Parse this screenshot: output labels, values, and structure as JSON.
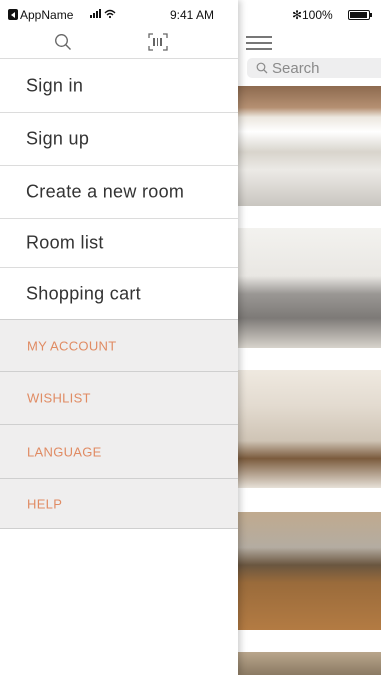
{
  "status_bar": {
    "app_name": "AppName",
    "time": "9:41 AM",
    "bluetooth": "✻",
    "battery_percent": "100%"
  },
  "drawer": {
    "menu_items": [
      {
        "label": "Sign in"
      },
      {
        "label": "Sign up"
      },
      {
        "label": "Create a new room"
      },
      {
        "label": "Room list"
      },
      {
        "label": "Shopping cart"
      }
    ],
    "section_items": [
      {
        "label": "MY ACCOUNT"
      },
      {
        "label": "WISHLIST"
      },
      {
        "label": "LANGUAGE"
      },
      {
        "label": "HELP"
      }
    ]
  },
  "main": {
    "search": {
      "placeholder": "Search"
    },
    "photos": [
      {
        "name": "bedroom-photo"
      },
      {
        "name": "living-room-photo"
      },
      {
        "name": "dining-room-photo"
      },
      {
        "name": "hallway-photo"
      },
      {
        "name": "plant-photo"
      }
    ]
  },
  "colors": {
    "accent": "#e08b63",
    "section_bg": "#efeeee",
    "divider": "#dcdcdc"
  },
  "icons": [
    "search-icon",
    "scan-icon",
    "menu-icon",
    "bluetooth-icon",
    "battery-icon",
    "back-icon",
    "signal-icon",
    "wifi-icon"
  ]
}
